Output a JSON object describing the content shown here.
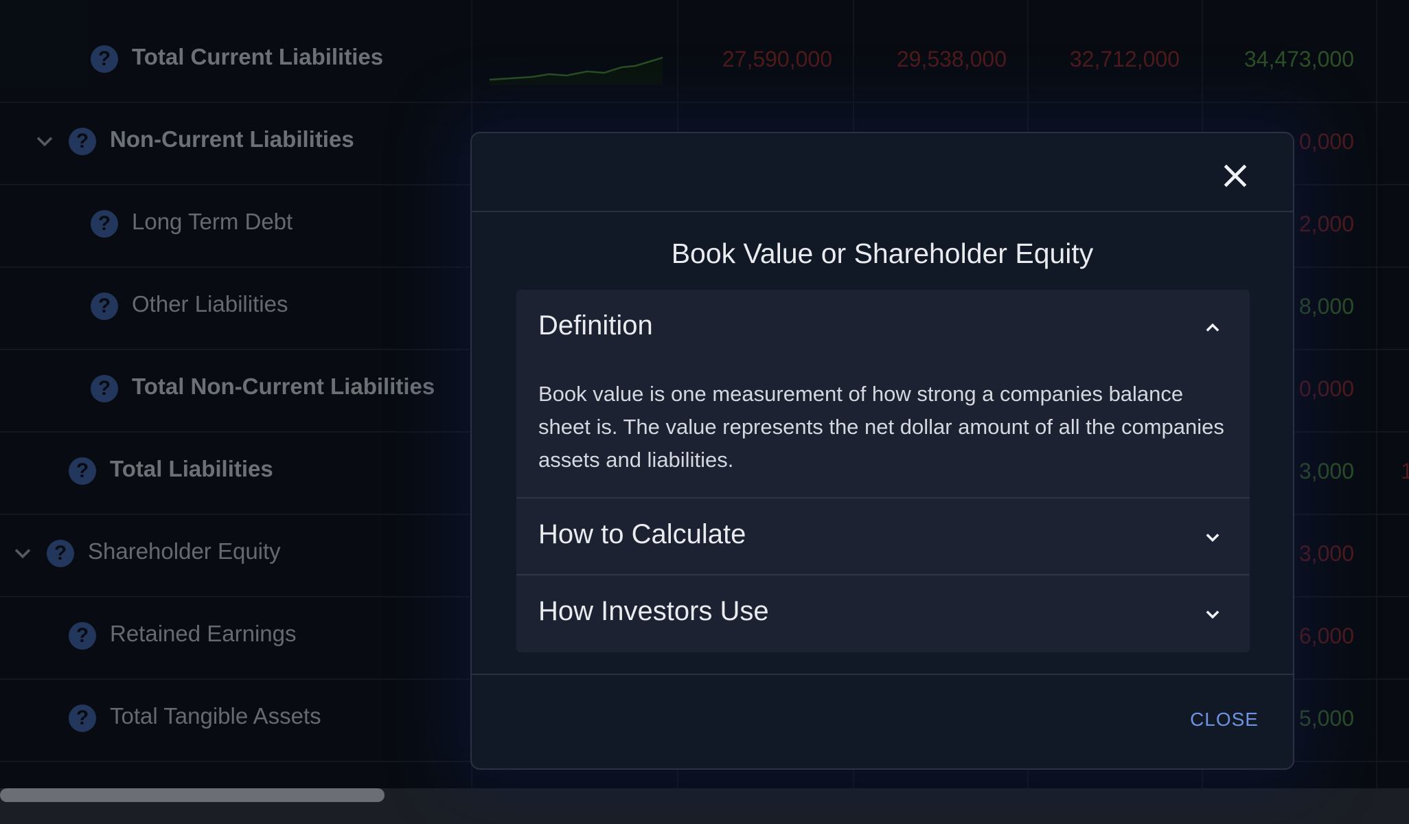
{
  "table": {
    "rows": [
      {
        "label": "Total Current Liabilities",
        "bold": true,
        "values": [
          "27,590,000",
          "29,538,000",
          "32,712,000",
          "34,473,000"
        ]
      },
      {
        "label": "Non-Current Liabilities",
        "bold": true,
        "values": [
          "",
          "",
          "",
          "0,000"
        ]
      },
      {
        "label": "Long Term Debt",
        "bold": false,
        "values": [
          "",
          "",
          "",
          "2,000"
        ]
      },
      {
        "label": "Other Liabilities",
        "bold": false,
        "values": [
          "",
          "",
          "",
          "8,000"
        ]
      },
      {
        "label": "Total Non-Current Liabilities",
        "bold": true,
        "values": [
          "",
          "",
          "",
          "0,000"
        ]
      },
      {
        "label": "Total Liabilities",
        "bold": true,
        "values": [
          "",
          "",
          "",
          "3,000"
        ],
        "overflow": "1"
      },
      {
        "label": "Shareholder Equity",
        "bold": false,
        "values": [
          "",
          "",
          "",
          "3,000"
        ]
      },
      {
        "label": "Retained Earnings",
        "bold": false,
        "values": [
          "",
          "",
          "",
          "6,000"
        ]
      },
      {
        "label": "Total Tangible Assets",
        "bold": false,
        "values": [
          "",
          "",
          "",
          "5,000"
        ]
      }
    ]
  },
  "modal": {
    "title": "Book Value or Shareholder Equity",
    "close_label": "CLOSE",
    "sections": [
      {
        "title": "Definition",
        "expanded": true,
        "body": "Book value is one measurement of how strong a companies balance sheet is. The value represents the net dollar amount of all the companies assets and liabilities."
      },
      {
        "title": "How to Calculate",
        "expanded": false
      },
      {
        "title": "How Investors Use",
        "expanded": false
      }
    ]
  },
  "colors": {
    "background": "#0d1219",
    "negative": "#8e2a2a",
    "positive": "#4f8a3c",
    "help_icon": "#3e5f9f",
    "link": "#6f93e0"
  }
}
